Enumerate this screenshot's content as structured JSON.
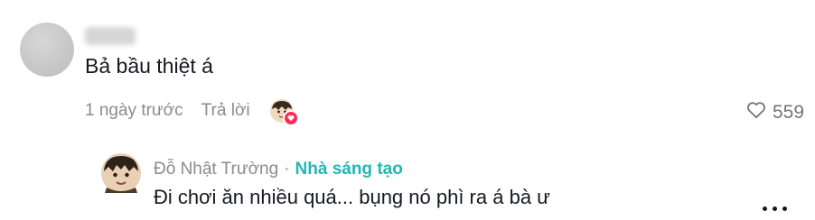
{
  "comment": {
    "text": "Bả bầu thiệt á",
    "time": "1 ngày trước",
    "reply_label": "Trả lời",
    "like_count": "559",
    "icons": {
      "like": "heart-outline-icon",
      "liked_badge": "heart-filled-icon"
    },
    "colors": {
      "badge": "#fe2c55",
      "meta": "#8a8b91"
    }
  },
  "reply": {
    "author": "Đỗ Nhật Trường",
    "separator": "·",
    "badge": "Nhà sáng tạo",
    "text": "Đi chơi ăn nhiều quá... bụng nó phì ra á bà ư",
    "icons": {
      "more": "more-dots-icon"
    },
    "colors": {
      "creator": "#20b7b5"
    }
  }
}
